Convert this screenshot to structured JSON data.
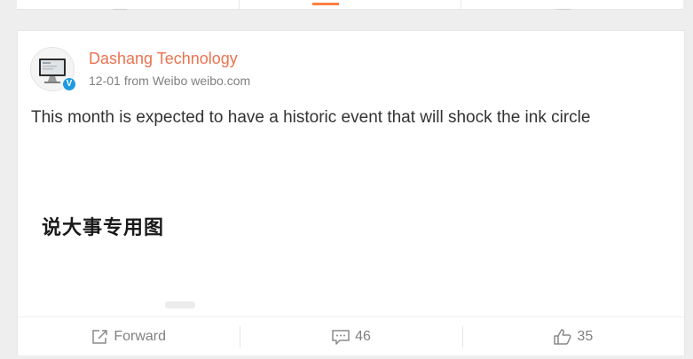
{
  "post": {
    "author": "Dashang Technology",
    "date": "12-01",
    "source_prefix": "from",
    "source_app": "Weibo",
    "source_site": "weibo.com",
    "text": "This month is expected to have a historic event that will shock the ink circle",
    "image_caption": "说大事专用图"
  },
  "actions": {
    "forward_label": "Forward",
    "comment_count": "46",
    "like_count": "35"
  },
  "icons": [
    "verified-icon",
    "forward-icon",
    "comment-icon",
    "like-icon"
  ],
  "colors": {
    "author": "#eb7350",
    "accent_tab": "#ff8140",
    "verified": "#1f9ae0",
    "meta": "#808080",
    "text": "#333333"
  }
}
